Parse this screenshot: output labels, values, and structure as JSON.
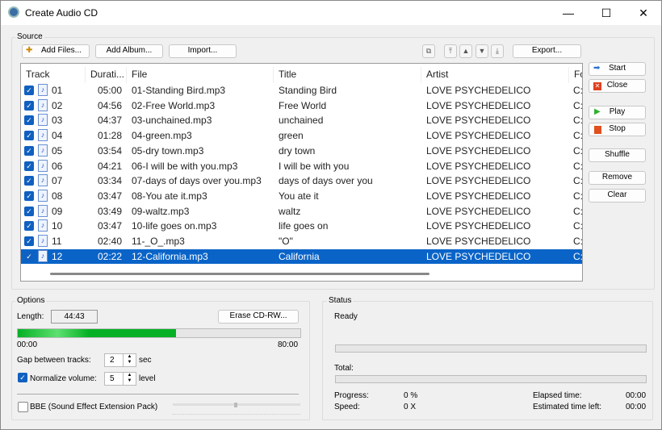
{
  "window": {
    "title": "Create Audio CD",
    "minimize": "—",
    "maximize": "☐",
    "close": "✕"
  },
  "source": {
    "label": "Source",
    "add_files": "Add Files...",
    "add_album": "Add Album...",
    "import": "Import...",
    "export": "Export...",
    "columns": [
      "Track",
      "Durati...",
      "File",
      "Title",
      "Artist",
      "Fo"
    ],
    "tracks": [
      {
        "track": "01",
        "duration": "05:00",
        "file": "01-Standing Bird.mp3",
        "title": "Standing Bird",
        "artist": "LOVE PSYCHEDELICO",
        "fo": "C:"
      },
      {
        "track": "02",
        "duration": "04:56",
        "file": "02-Free World.mp3",
        "title": "Free World",
        "artist": "LOVE PSYCHEDELICO",
        "fo": "C:"
      },
      {
        "track": "03",
        "duration": "04:37",
        "file": "03-unchained.mp3",
        "title": "unchained",
        "artist": "LOVE PSYCHEDELICO",
        "fo": "C:"
      },
      {
        "track": "04",
        "duration": "01:28",
        "file": "04-green.mp3",
        "title": "green",
        "artist": "LOVE PSYCHEDELICO",
        "fo": "C:"
      },
      {
        "track": "05",
        "duration": "03:54",
        "file": "05-dry town.mp3",
        "title": "dry town",
        "artist": "LOVE PSYCHEDELICO",
        "fo": "C:"
      },
      {
        "track": "06",
        "duration": "04:21",
        "file": "06-I will be with you.mp3",
        "title": "I will be with you",
        "artist": "LOVE PSYCHEDELICO",
        "fo": "C:"
      },
      {
        "track": "07",
        "duration": "03:34",
        "file": "07-days of days over you.mp3",
        "title": "days of days over you",
        "artist": "LOVE PSYCHEDELICO",
        "fo": "C:"
      },
      {
        "track": "08",
        "duration": "03:47",
        "file": "08-You ate it.mp3",
        "title": "You ate it",
        "artist": "LOVE PSYCHEDELICO",
        "fo": "C:"
      },
      {
        "track": "09",
        "duration": "03:49",
        "file": "09-waltz.mp3",
        "title": "waltz",
        "artist": "LOVE PSYCHEDELICO",
        "fo": "C:"
      },
      {
        "track": "10",
        "duration": "03:47",
        "file": "10-life goes on.mp3",
        "title": "life goes on",
        "artist": "LOVE PSYCHEDELICO",
        "fo": "C:"
      },
      {
        "track": "11",
        "duration": "02:40",
        "file": "11-_O_.mp3",
        "title": "\"O\"",
        "artist": "LOVE PSYCHEDELICO",
        "fo": "C:"
      },
      {
        "track": "12",
        "duration": "02:22",
        "file": "12-California.mp3",
        "title": "California",
        "artist": "LOVE PSYCHEDELICO",
        "fo": "C:"
      }
    ],
    "selected_index": 11
  },
  "side": {
    "start": "Start",
    "close": "Close",
    "play": "Play",
    "stop": "Stop",
    "shuffle": "Shuffle",
    "remove": "Remove",
    "clear": "Clear"
  },
  "options": {
    "label": "Options",
    "length_label": "Length:",
    "length": "44:43",
    "erase": "Erase CD-RW...",
    "bar_start": "00:00",
    "bar_end": "80:00",
    "fill_percent": 55.9,
    "gap_label": "Gap between tracks:",
    "gap": "2",
    "gap_unit": "sec",
    "normalize_label": "Normalize volume:",
    "normalize_checked": true,
    "normalize": "5",
    "normalize_unit": "level",
    "bbe_label": "BBE (Sound Effect Extension Pack)",
    "bbe_checked": false
  },
  "status": {
    "label": "Status",
    "state": "Ready",
    "total_label": "Total:",
    "progress_label": "Progress:",
    "progress": "0 %",
    "speed_label": "Speed:",
    "speed": "0 X",
    "elapsed_label": "Elapsed time:",
    "elapsed": "00:00",
    "left_label": "Estimated time left:",
    "left": "00:00"
  },
  "colors": {
    "selection": "#0a64c8",
    "progress_fill": "#06b025"
  }
}
